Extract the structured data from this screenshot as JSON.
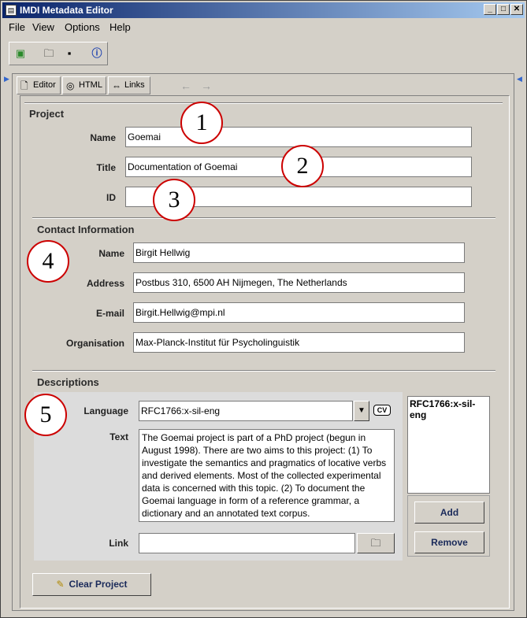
{
  "window": {
    "title": "IMDI Metadata Editor",
    "min": "_",
    "max": "□",
    "close": "✕"
  },
  "menu": [
    "File",
    "View",
    "Options",
    "Help"
  ],
  "tabs": {
    "editor": "Editor",
    "html": "HTML",
    "links": "Links"
  },
  "project": {
    "section": "Project",
    "name_label": "Name",
    "name_value": "Goemai",
    "title_label": "Title",
    "title_value": "Documentation of Goemai",
    "id_label": "ID",
    "id_value": ""
  },
  "contact": {
    "section": "Contact Information",
    "name_label": "Name",
    "name_value": "Birgit Hellwig",
    "address_label": "Address",
    "address_value": "Postbus 310, 6500 AH Nijmegen, The Netherlands",
    "email_label": "E-mail",
    "email_value": "Birgit.Hellwig@mpi.nl",
    "org_label": "Organisation",
    "org_value": "Max-Planck-Institut für Psycholinguistik"
  },
  "descriptions": {
    "section": "Descriptions",
    "language_label": "Language",
    "language_value": "RFC1766:x-sil-eng",
    "cv_label": "CV",
    "text_label": "Text",
    "text_value": "The Goemai project is part of a PhD project (begun in August 1998). There are two aims to this project: (1) To investigate the semantics and pragmatics of locative verbs and derived elements. Most of the collected experimental data is concerned with this topic. (2) To document the Goemai language in form of a reference grammar, a dictionary and an annotated text corpus.",
    "link_label": "Link",
    "link_value": "",
    "list_item": "RFC1766:x-sil-eng",
    "add_label": "Add",
    "remove_label": "Remove"
  },
  "clear_project_label": "Clear Project",
  "markers": [
    "1",
    "2",
    "3",
    "4",
    "5"
  ]
}
